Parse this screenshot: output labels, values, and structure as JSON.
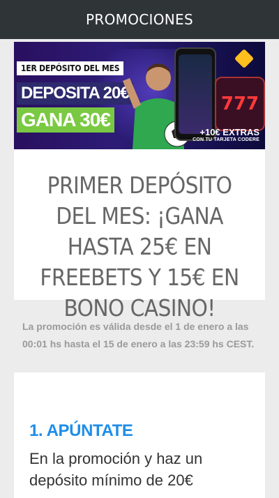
{
  "header": {
    "title": "PROMOCIONES"
  },
  "banner": {
    "tag": "1ER DEPÓSITO DEL MES",
    "deposit_line": "DEPOSITA 20€",
    "win_line": "GANA 30€",
    "phone_brand": "codere",
    "slot_text": "777",
    "extra_line": "+10€ EXTRAS",
    "extra_small": "CON TU TARJETA CODERE"
  },
  "promo": {
    "headline": "PRIMER DEPÓSITO DEL MES: ¡GANA HASTA 25€ EN FREEBETS Y 15€ EN BONO CASINO!",
    "validity": "La promoción es válida desde el 1 de enero a las 00:01 hs hasta el 15 de enero a las 23:59 hs CEST."
  },
  "steps": [
    {
      "title": "1. APÚNTATE",
      "text": "En la promoción y haz un depósito mínimo de 20€"
    }
  ]
}
